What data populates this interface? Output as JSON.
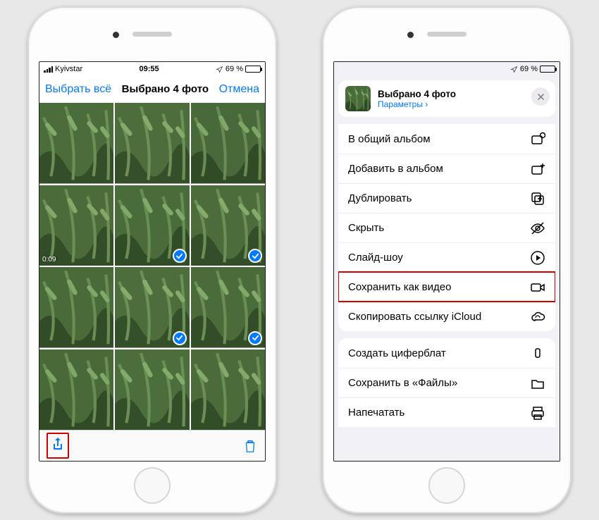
{
  "phone1": {
    "statusbar": {
      "carrier": "Kyivstar",
      "time": "09:55",
      "battery": "69 %"
    },
    "nav": {
      "select_all": "Выбрать всё",
      "title": "Выбрано 4 фото",
      "cancel": "Отмена"
    },
    "grid": {
      "video_duration": "0:09",
      "selected_indices": [
        4,
        5,
        7,
        8
      ]
    }
  },
  "phone2": {
    "statusbar": {
      "battery": "69 %"
    },
    "sheet": {
      "title": "Выбрано 4 фото",
      "params": "Параметры",
      "close_icon": "close-icon"
    },
    "actions": {
      "g1": [
        {
          "label": "В общий альбом",
          "icon": "shared-album-icon"
        },
        {
          "label": "Добавить в альбом",
          "icon": "add-album-icon"
        },
        {
          "label": "Дублировать",
          "icon": "duplicate-icon"
        },
        {
          "label": "Скрыть",
          "icon": "hide-icon"
        },
        {
          "label": "Слайд-шоу",
          "icon": "play-icon"
        },
        {
          "label": "Сохранить как видео",
          "icon": "video-icon",
          "highlight": true
        },
        {
          "label": "Скопировать ссылку iCloud",
          "icon": "cloud-icon"
        }
      ],
      "g2": [
        {
          "label": "Создать циферблат",
          "icon": "watch-icon"
        },
        {
          "label": "Сохранить в «Файлы»",
          "icon": "folder-icon"
        },
        {
          "label": "Напечатать",
          "icon": "print-icon"
        }
      ]
    }
  }
}
